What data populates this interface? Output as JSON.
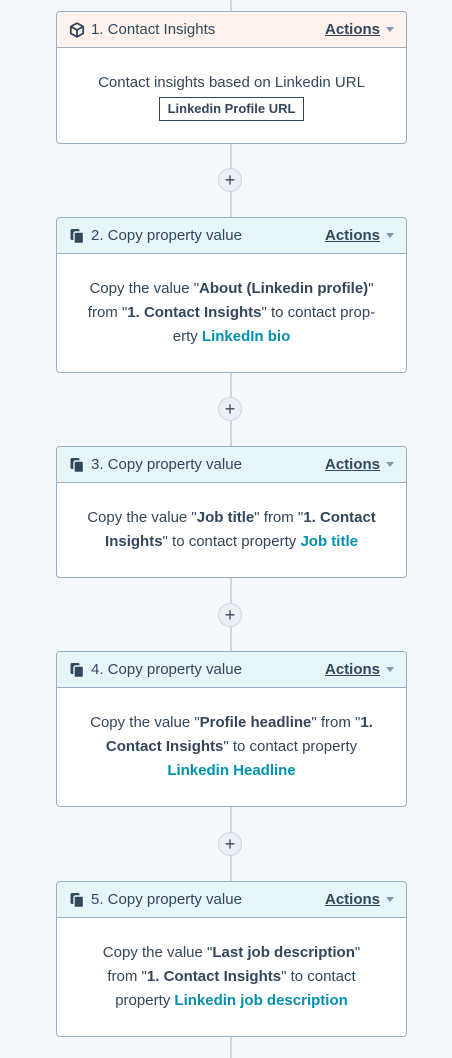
{
  "steps": [
    {
      "title": "1. Contact Insights",
      "actions_label": "Actions",
      "description": "Contact insights based on Linkedin URL",
      "tag": "Linkedin Profile URL"
    },
    {
      "title": "2. Copy property value",
      "actions_label": "Actions",
      "p1": "Copy the value \"",
      "v1": "About (Linkedin profile)",
      "p2": "\" from \"",
      "v2": "1. Contact Insights",
      "p3": "\" to contact prop-erty ",
      "target": "LinkedIn bio"
    },
    {
      "title": "3. Copy property value",
      "actions_label": "Actions",
      "p1": "Copy the value \"",
      "v1": "Job title",
      "p2": "\" from \"",
      "v2": "1. Contact Insights",
      "p3": "\" to contact property ",
      "target": "Job title"
    },
    {
      "title": "4. Copy property value",
      "actions_label": "Actions",
      "p1": "Copy the value \"",
      "v1": "Profile headline",
      "p2": "\" from \"",
      "v2": "1. Contact Insights",
      "p3": "\" to contact property ",
      "target": "Linkedin Headline"
    },
    {
      "title": "5. Copy property value",
      "actions_label": "Actions",
      "p1": "Copy the value \"",
      "v1": "Last job description",
      "p2": "\" from \"",
      "v2": "1. Contact Insights",
      "p3": "\" to contact property ",
      "target": "Linkedin job description"
    }
  ],
  "add_step_symbol": "+",
  "colors": {
    "page_bg": "#f5f8fa",
    "card_border": "#99afc4",
    "header_orange": "#fdf3ec",
    "header_blue": "#e5f5f8",
    "link": "#0091ae",
    "text": "#33475b",
    "connector": "#cbd6e2"
  },
  "icons": {
    "step1": "cube-icon",
    "copy_steps": "copy-icon",
    "actions_menu": "caret-down-icon"
  }
}
